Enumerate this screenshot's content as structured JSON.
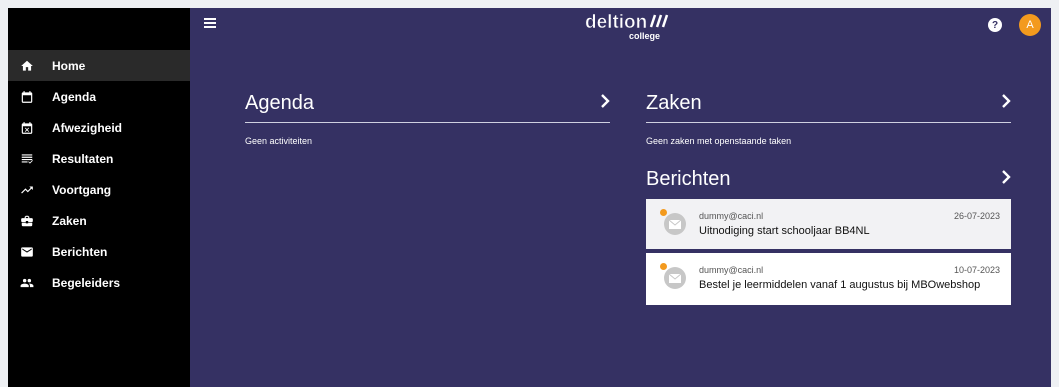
{
  "sidebar": {
    "items": [
      {
        "label": "Home",
        "icon": "home-icon"
      },
      {
        "label": "Agenda",
        "icon": "calendar-icon"
      },
      {
        "label": "Afwezigheid",
        "icon": "calendar-x-icon"
      },
      {
        "label": "Resultaten",
        "icon": "results-list-icon"
      },
      {
        "label": "Voortgang",
        "icon": "trending-up-icon"
      },
      {
        "label": "Zaken",
        "icon": "briefcase-icon"
      },
      {
        "label": "Berichten",
        "icon": "mail-icon"
      },
      {
        "label": "Begeleiders",
        "icon": "people-icon"
      }
    ],
    "active": "Home"
  },
  "header": {
    "logo_main": "deltion",
    "logo_sub": "college",
    "help_label": "?",
    "avatar_initial": "A"
  },
  "agenda": {
    "title": "Agenda",
    "empty_text": "Geen activiteiten"
  },
  "zaken": {
    "title": "Zaken",
    "empty_text": "Geen zaken met openstaande taken"
  },
  "berichten": {
    "title": "Berichten",
    "messages": [
      {
        "from": "dummy@caci.nl",
        "date": "26-07-2023",
        "subject": "Uitnodiging start schooljaar BB4NL"
      },
      {
        "from": "dummy@caci.nl",
        "date": "10-07-2023",
        "subject": "Bestel je leermiddelen vanaf 1 augustus bij MBOwebshop"
      }
    ]
  },
  "colors": {
    "main_bg": "#353163",
    "sidebar_bg": "#000000",
    "accent": "#f39a1e"
  }
}
